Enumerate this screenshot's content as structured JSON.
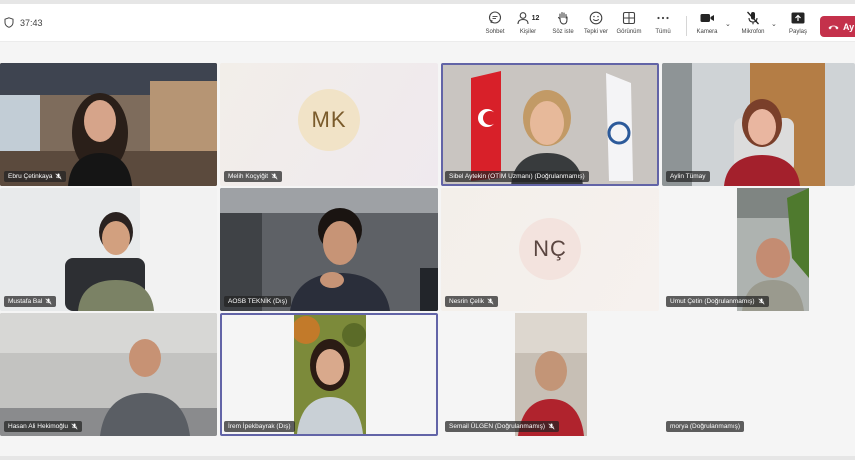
{
  "meeting": {
    "timer": "37:43"
  },
  "toolbar": {
    "chat": "Sohbet",
    "people": "Kişiler",
    "people_count": "12",
    "raise_hand": "Söz iste",
    "react": "Tepki ver",
    "view": "Görünüm",
    "more": "Tümü",
    "camera": "Kamera",
    "mic": "Mikrofon",
    "share": "Paylaş",
    "leave": "Ay"
  },
  "participants": [
    {
      "name": "Ebru Çetinkaya"
    },
    {
      "name": "Melih Koçyiğit",
      "initials": "MK"
    },
    {
      "name": "Sibel Aytekin (OTİM Uzmanı) (Doğrulanmamış)"
    },
    {
      "name": "Aylin Tümay"
    },
    {
      "name": "Mustafa Bal"
    },
    {
      "name": "AOSB TEKNİK (Dış)"
    },
    {
      "name": "Nesrin Çelik",
      "initials": "NÇ"
    },
    {
      "name": "Umut Çetin (Doğrulanmamış)"
    },
    {
      "name": "Hasan Ali Hekimoğlu"
    },
    {
      "name": "İrem İpekbayrak (Dış)"
    },
    {
      "name": "Semail ÜLGEN (Doğrulanmamış)"
    },
    {
      "name": "morya (Doğrulanmamış)"
    }
  ]
}
